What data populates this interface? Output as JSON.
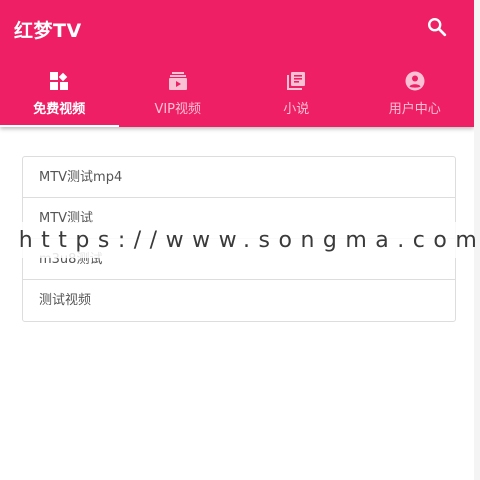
{
  "app": {
    "title": "红梦TV",
    "accent_color": "#ee1f65",
    "search_icon": "search-icon"
  },
  "tabs": [
    {
      "label": "免费视频",
      "icon": "dashboard-icon",
      "active": true
    },
    {
      "label": "VIP视频",
      "icon": "video-library-icon",
      "active": false
    },
    {
      "label": "小说",
      "icon": "book-icon",
      "active": false
    },
    {
      "label": "用户中心",
      "icon": "account-circle-icon",
      "active": false
    }
  ],
  "list": {
    "items": [
      "MTV测试mp4",
      "MTV测试",
      "m3u8测试",
      "测试视频"
    ]
  },
  "watermark": {
    "text": "https://www.songma.com"
  }
}
